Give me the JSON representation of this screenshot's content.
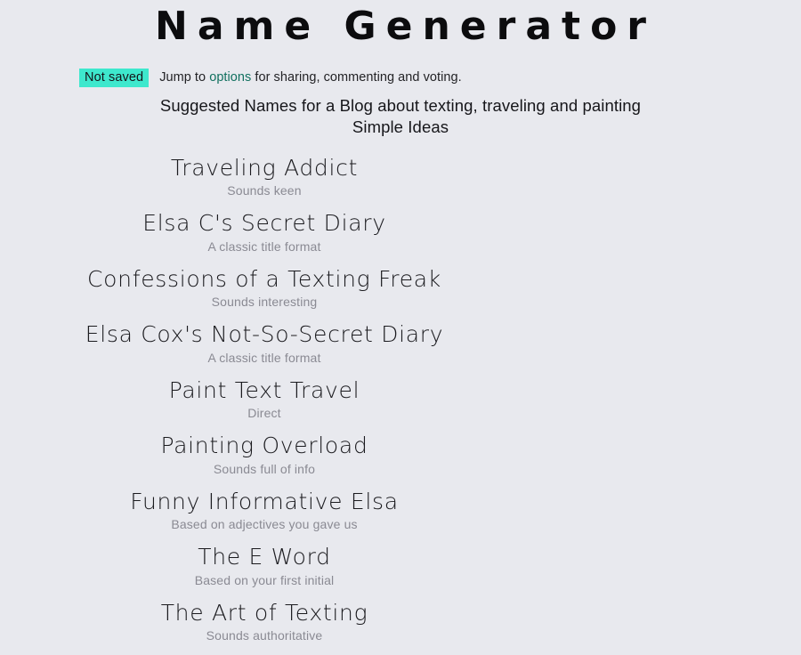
{
  "app": {
    "title": "Name Generator",
    "background_color": "#e8e9ee"
  },
  "status": {
    "badge_label": "Not saved",
    "badge_color": "#3ee8cd",
    "jump_prefix": "Jump to ",
    "jump_link_label": "options",
    "jump_suffix": " for sharing, commenting and voting.",
    "link_color": "#11705f"
  },
  "headings": {
    "line1": "Suggested Names for a Blog about texting, traveling and painting",
    "line2": "Simple Ideas"
  },
  "names": [
    {
      "title": "Traveling Addict",
      "subtitle": "Sounds keen"
    },
    {
      "title": "Elsa C's Secret Diary",
      "subtitle": "A classic title format"
    },
    {
      "title": "Confessions of a Texting Freak",
      "subtitle": "Sounds interesting"
    },
    {
      "title": "Elsa Cox's Not-So-Secret Diary",
      "subtitle": "A classic title format"
    },
    {
      "title": "Paint Text Travel",
      "subtitle": "Direct"
    },
    {
      "title": "Painting Overload",
      "subtitle": "Sounds full of info"
    },
    {
      "title": "Funny Informative Elsa",
      "subtitle": "Based on adjectives you gave us"
    },
    {
      "title": "The E Word",
      "subtitle": "Based on your first initial"
    },
    {
      "title": "The Art of Texting",
      "subtitle": "Sounds authoritative"
    }
  ]
}
